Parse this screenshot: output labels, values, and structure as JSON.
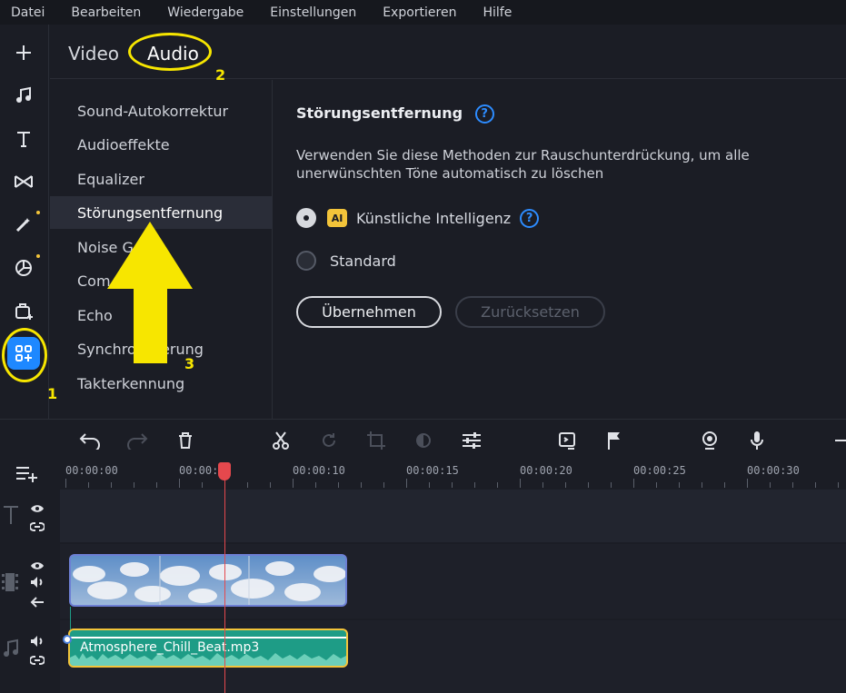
{
  "menu": [
    "Datei",
    "Bearbeiten",
    "Wiedergabe",
    "Einstellungen",
    "Exportieren",
    "Hilfe"
  ],
  "tabs": {
    "video": "Video",
    "audio": "Audio"
  },
  "submenu": [
    "Sound-Autokorrektur",
    "Audioeffekte",
    "Equalizer",
    "Störungsentfernung",
    "Noise G",
    "Com",
    "Echo",
    "Synchronisierung",
    "Takterkennung"
  ],
  "panel": {
    "title": "Störungsentfernung",
    "help": "?",
    "description": "Verwenden Sie diese Methoden zur Rauschunterdrückung, um alle unerwünschten Töne automatisch zu löschen",
    "option_ai_badge": "AI",
    "option_ai": "Künstliche Intelligenz",
    "option_standard": "Standard",
    "apply": "Übernehmen",
    "reset": "Zurücksetzen"
  },
  "timeline": {
    "ruler": [
      "00:00:00",
      "00:00:",
      "00:00:10",
      "00:00:15",
      "00:00:20",
      "00:00:25",
      "00:00:30"
    ],
    "audio_clip": "Atmosphere_Chill_Beat.mp3"
  },
  "annotations": {
    "n1": "1",
    "n2": "2",
    "n3": "3"
  },
  "colors": {
    "accent": "#1e88ff",
    "annotation": "#f7e600",
    "playhead": "#e5484d",
    "audio_clip": "#1e9c86",
    "video_clip_border": "#6d7fd4"
  }
}
